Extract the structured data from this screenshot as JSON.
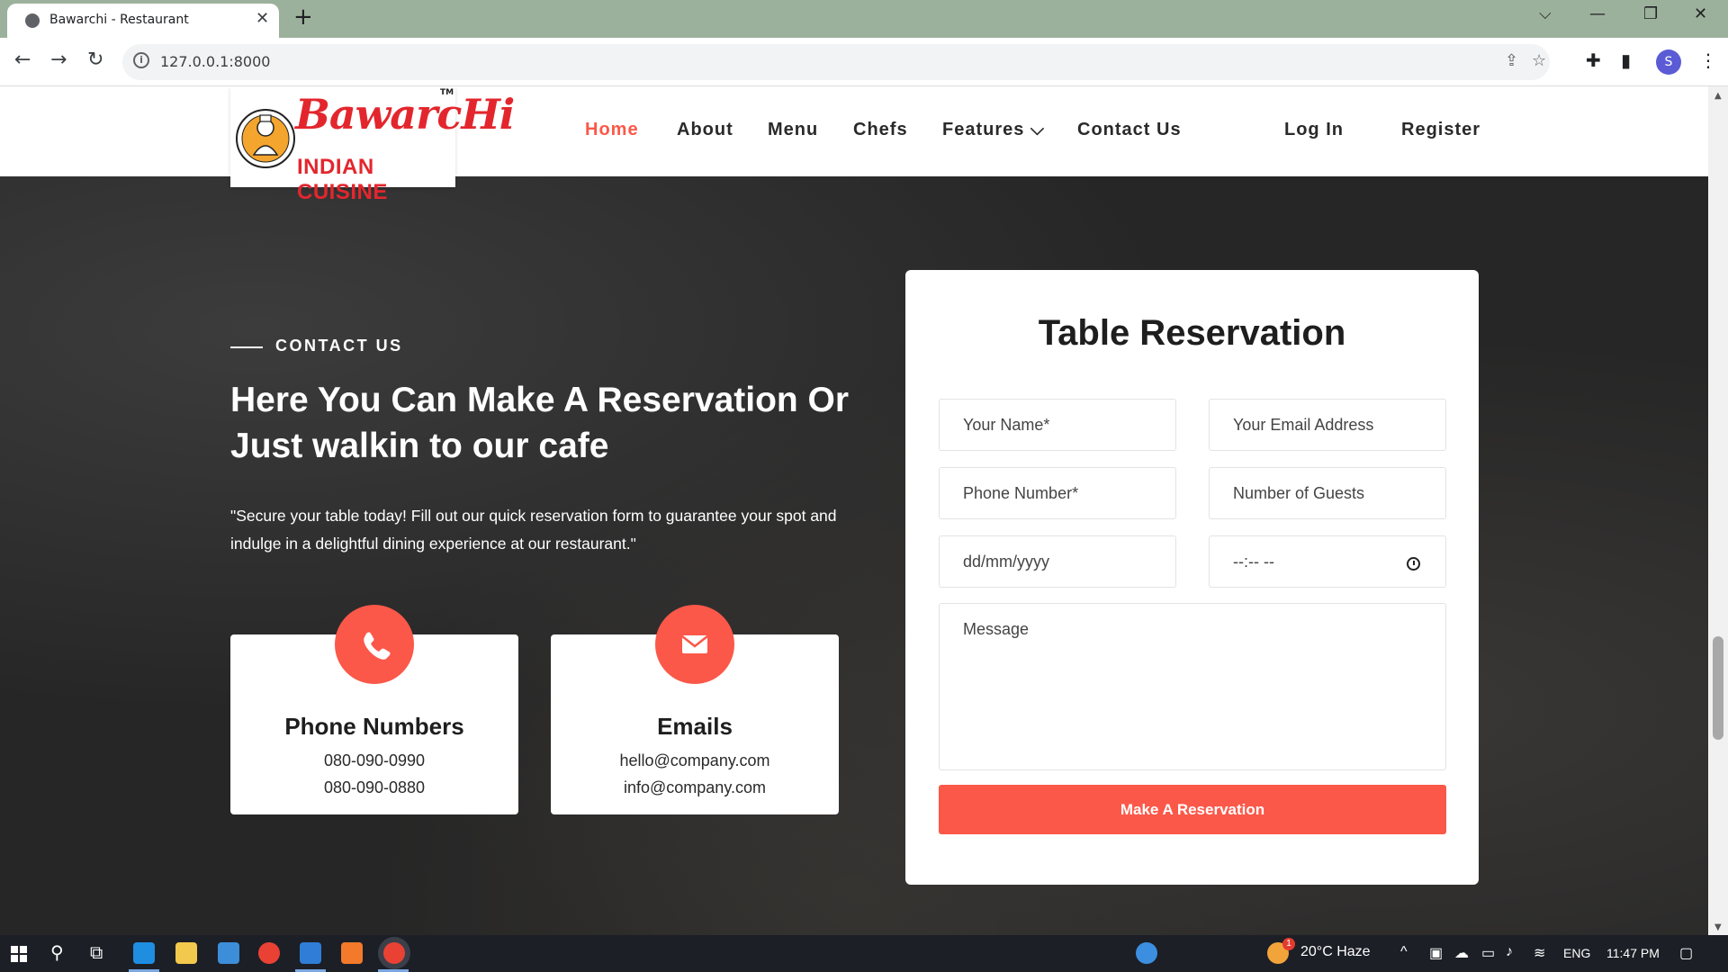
{
  "browser": {
    "tab_title": "Bawarchi - Restaurant",
    "tab_close": "✕",
    "new_tab": "+",
    "url": "127.0.0.1:8000",
    "profile_initial": "S",
    "icons": [
      "back-arrow-icon",
      "forward-arrow-icon",
      "reload-icon",
      "site-info-icon",
      "share-icon",
      "star-icon",
      "extensions-icon",
      "side-panel-icon",
      "kebab-menu-icon"
    ]
  },
  "site": {
    "logo_word": "BawarcHi",
    "logo_sub": "INDIAN CUISINE",
    "logo_tm": "TM",
    "nav": [
      {
        "label": "Home",
        "active": true
      },
      {
        "label": "About"
      },
      {
        "label": "Menu"
      },
      {
        "label": "Chefs"
      },
      {
        "label": "Features ⌵"
      },
      {
        "label": "Contact Us"
      }
    ],
    "auth": {
      "login": "Log In",
      "register": "Register"
    }
  },
  "contact": {
    "eyebrow": "CONTACT US",
    "headline": "Here You Can Make A Reservation Or Just walkin to our cafe",
    "lede": "\"Secure your table today! Fill out our quick reservation form to guarantee your spot and indulge in a delightful dining experience at our restaurant.\"",
    "phone_card": {
      "title": "Phone Numbers",
      "lines": [
        "080-090-0990",
        "080-090-0880"
      ],
      "icon": "phone-icon"
    },
    "email_card": {
      "title": "Emails",
      "lines": [
        "hello@company.com",
        "info@company.com"
      ],
      "icon": "envelope-icon"
    }
  },
  "form": {
    "title": "Table Reservation",
    "name_placeholder": "Your Name*",
    "email_placeholder": "Your Email Address",
    "phone_placeholder": "Phone Number*",
    "guests_placeholder": "Number of Guests",
    "date_placeholder": "dd/mm/yyyy",
    "time_placeholder": "--:-- --",
    "message_placeholder": "Message",
    "submit_label": "Make A Reservation"
  },
  "taskbar": {
    "weather": "20°C  Haze",
    "weather_badge": "1",
    "language": "ENG",
    "time": "11:47 PM"
  },
  "colors": {
    "accent": "#fb5849",
    "tabbar": "#9cb19b",
    "taskbar": "#1c1f26"
  }
}
